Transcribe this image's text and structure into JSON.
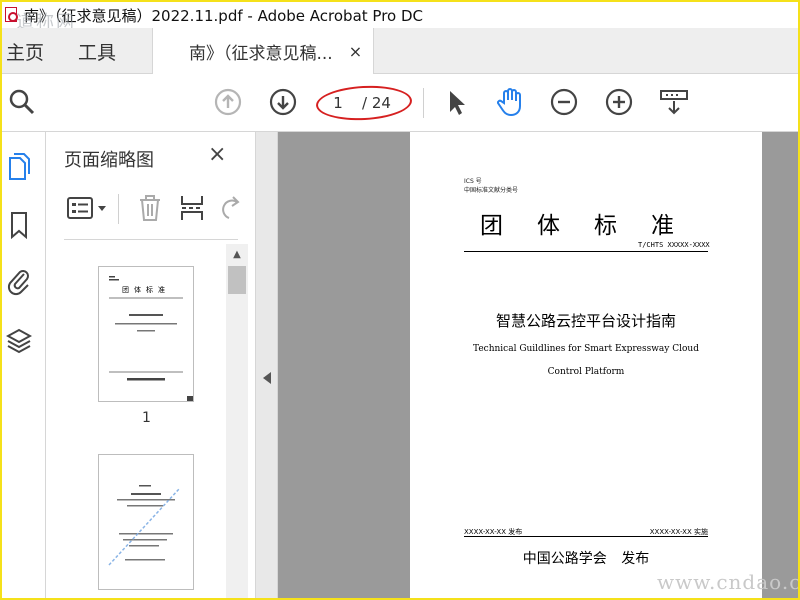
{
  "window": {
    "title": "南》（征求意见稿）2022.11.pdf - Adobe Acrobat Pro DC",
    "watermark_top": "道称网"
  },
  "tabs": {
    "home": "主页",
    "tools": "工具",
    "document": "南》（征求意见稿...",
    "document_close": "×"
  },
  "toolbar": {
    "icons": [
      "search-icon",
      "prev-page-icon",
      "next-page-icon",
      "select-arrow-icon",
      "hand-icon",
      "zoom-out-icon",
      "zoom-in-icon",
      "marquee-zoom-icon"
    ],
    "current_page": "1",
    "total_pages": "/ 24",
    "hand_color": "#2680eb"
  },
  "rail": {
    "icons": [
      "page-thumbnails-icon",
      "bookmark-icon",
      "attachment-icon",
      "layers-icon"
    ],
    "active_color": "#2680eb"
  },
  "panel": {
    "title": "页面缩略图",
    "close": "×",
    "thumbs": [
      {
        "label": "1"
      },
      {
        "label": ""
      }
    ]
  },
  "page": {
    "ics": "ICS 号",
    "classification": "中国标准文献分类号",
    "standard_type": "团体标准",
    "standard_number": "T/CHTS XXXXX-XXXX",
    "title_zh": "智慧公路云控平台设计指南",
    "title_en": "Technical Guildlines for Smart Expressway Cloud Control Platform",
    "publish_date": "XXXX-XX-XX 发布",
    "implement_date": "XXXX-XX-XX 实施",
    "publisher": "中国公路学会 发布"
  },
  "watermark": "www.cndao.c"
}
